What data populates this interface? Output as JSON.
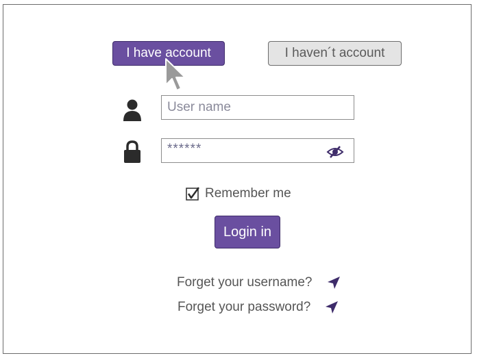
{
  "tabs": {
    "have_account_label": "I have account",
    "havent_account_label": "I haven´t account"
  },
  "form": {
    "username_placeholder": "User name",
    "password_value": "******",
    "remember_label": "Remember me",
    "remember_checked": true,
    "login_label": "Login in"
  },
  "links": {
    "forget_username": "Forget your username?",
    "forget_password": "Forget your password?"
  },
  "icons": {
    "user": "user-icon",
    "lock": "lock-icon",
    "eye": "eye-hidden-icon",
    "arrow": "location-arrow-icon",
    "cursor": "mouse-pointer-icon",
    "checkbox": "checkmark-icon"
  },
  "colors": {
    "accent": "#6a4fa0",
    "accent_dark": "#3e2c6a",
    "inactive_tab": "#e4e4e4",
    "text": "#555555"
  }
}
